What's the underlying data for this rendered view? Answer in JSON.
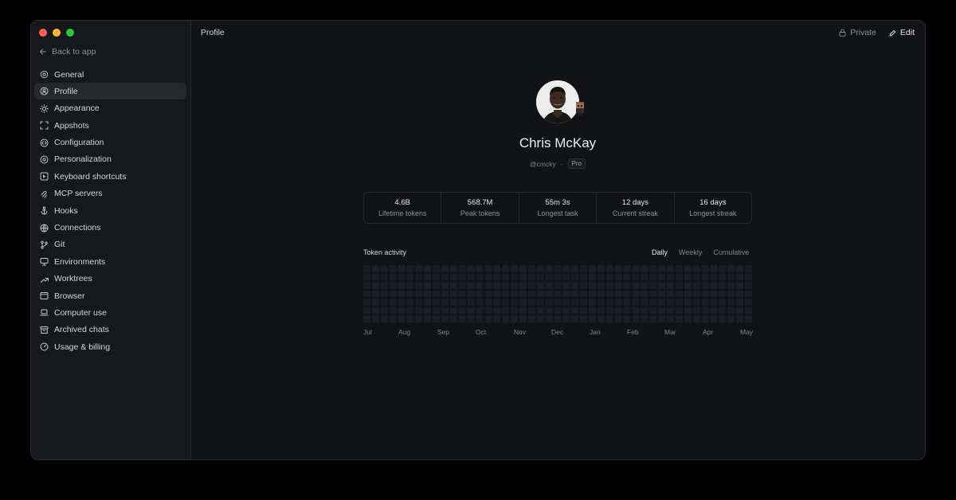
{
  "window": {
    "title": "Profile"
  },
  "sidebar": {
    "back_label": "Back to app",
    "items": [
      {
        "label": "General",
        "icon": "gear-icon"
      },
      {
        "label": "Profile",
        "icon": "user-circle-icon",
        "active": true
      },
      {
        "label": "Appearance",
        "icon": "sun-icon"
      },
      {
        "label": "Appshots",
        "icon": "screenshot-frame-icon"
      },
      {
        "label": "Configuration",
        "icon": "code-circle-icon"
      },
      {
        "label": "Personalization",
        "icon": "palette-icon"
      },
      {
        "label": "Keyboard shortcuts",
        "icon": "keyboard-key-icon"
      },
      {
        "label": "MCP servers",
        "icon": "mcp-icon"
      },
      {
        "label": "Hooks",
        "icon": "anchor-icon"
      },
      {
        "label": "Connections",
        "icon": "globe-icon"
      },
      {
        "label": "Git",
        "icon": "git-branch-icon"
      },
      {
        "label": "Environments",
        "icon": "monitor-icon"
      },
      {
        "label": "Worktrees",
        "icon": "tree-branch-icon"
      },
      {
        "label": "Browser",
        "icon": "browser-window-icon"
      },
      {
        "label": "Computer use",
        "icon": "laptop-icon"
      },
      {
        "label": "Archived chats",
        "icon": "archive-box-icon"
      },
      {
        "label": "Usage & billing",
        "icon": "gauge-icon"
      }
    ]
  },
  "topbar": {
    "private_label": "Private",
    "edit_label": "Edit"
  },
  "profile": {
    "name": "Chris McKay",
    "handle": "@cmcky",
    "separator": "·",
    "plan": "Pro"
  },
  "stats": [
    {
      "value": "4.6B",
      "label": "Lifetime tokens"
    },
    {
      "value": "568.7M",
      "label": "Peak tokens"
    },
    {
      "value": "55m 3s",
      "label": "Longest task"
    },
    {
      "value": "12 days",
      "label": "Current streak"
    },
    {
      "value": "16 days",
      "label": "Longest streak"
    }
  ],
  "activity": {
    "title": "Token activity",
    "tabs": [
      "Daily",
      "Weekly",
      "Cumulative"
    ],
    "active_tab": "Daily",
    "months": [
      "Jul",
      "Aug",
      "Sep",
      "Oct",
      "Nov",
      "Dec",
      "Jan",
      "Feb",
      "Mar",
      "Apr",
      "May"
    ],
    "colors": [
      "#1a1d23",
      "#27374f",
      "#34507a",
      "#5f86c4",
      "#a9c6f3"
    ],
    "levels": [
      "000000000000000000000000000000000000000000000",
      "000000000000000000000000000000000000000000000",
      "000000000000000000000000000000000000000000000",
      "000000000000000000000000000000000000000000000",
      "000000000000000000000000000000000000000000000",
      "000000000000000000000000000000000000000000000",
      "000000000000000000000000000000000000000000000"
    ]
  }
}
